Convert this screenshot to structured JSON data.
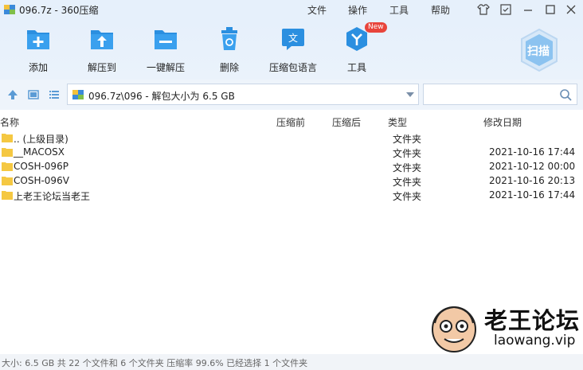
{
  "window": {
    "title": "096.7z - 360压缩",
    "menu": [
      "文件",
      "操作",
      "工具",
      "帮助"
    ]
  },
  "toolbar": {
    "items": [
      {
        "label": "添加",
        "icon": "add-icon"
      },
      {
        "label": "解压到",
        "icon": "extract-to-icon"
      },
      {
        "label": "一键解压",
        "icon": "one-click-extract-icon"
      },
      {
        "label": "删除",
        "icon": "delete-icon"
      },
      {
        "label": "压缩包语言",
        "icon": "archive-language-icon"
      },
      {
        "label": "工具",
        "icon": "tools-icon"
      }
    ],
    "new_badge": "New",
    "scan_label": "扫描"
  },
  "address": {
    "path": "096.7z\\096 - 解包大小为 6.5 GB",
    "search_placeholder": ""
  },
  "columns": {
    "name": "名称",
    "packed": "压缩前",
    "compressed": "压缩后",
    "type": "类型",
    "modified": "修改日期"
  },
  "files": [
    {
      "name": ".. (上级目录)",
      "type": "文件夹",
      "date": ""
    },
    {
      "name": "__MACOSX",
      "type": "文件夹",
      "date": "2021-10-16 17:44"
    },
    {
      "name": "COSH-096P",
      "type": "文件夹",
      "date": "2021-10-12 00:00"
    },
    {
      "name": "COSH-096V",
      "type": "文件夹",
      "date": "2021-10-16 20:13"
    },
    {
      "name": "上老王论坛当老王",
      "type": "文件夹",
      "date": "2021-10-16 17:44"
    }
  ],
  "status": "大小: 6.5 GB 共 22 个文件和 6 个文件夹 压缩率 99.6% 已经选择 1 个文件夹",
  "watermark": {
    "title": "老王论坛",
    "url": "laowang.vip"
  },
  "colors": {
    "accent": "#2b8fe0",
    "toolbar_bg": "#e6f0fb",
    "folder": "#f5c842",
    "badge": "#e8443b"
  }
}
